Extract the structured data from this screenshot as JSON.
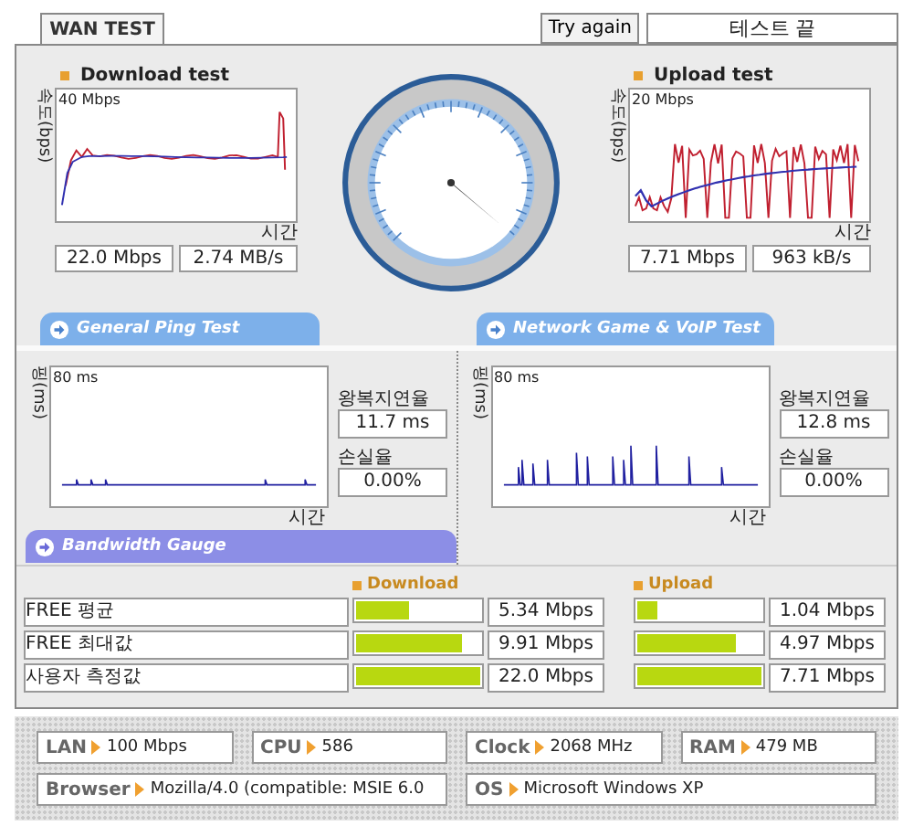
{
  "tab": {
    "label": "WAN TEST",
    "selected": true
  },
  "try_again_button": "Try again",
  "status": "테스트 끝",
  "speed_tests": [
    {
      "title": "Download test",
      "axis_label": "속도(bps)",
      "scale": "40 Mbps",
      "x_label": "시간",
      "speed": "22.0 Mbps",
      "rate": "2.74 MB/s",
      "kind": "download"
    },
    {
      "title": "Upload test",
      "axis_label": "속도(bps)",
      "scale": "20 Mbps",
      "x_label": "시간",
      "speed": "7.71 Mbps",
      "rate": "963 kB/s",
      "kind": "upload"
    }
  ],
  "ping_tests": [
    {
      "title": "General Ping Test",
      "axis_label": "핑(ms)",
      "scale": "80 ms",
      "x_label": "시간",
      "latency_label": "왕복지연율",
      "latency": "11.7 ms",
      "loss_label": "손실율",
      "loss": "0.00%",
      "kind": "quiet"
    },
    {
      "title": "Network Game & VoIP Test",
      "axis_label": "핑(ms)",
      "scale": "80 ms",
      "x_label": "시간",
      "latency_label": "왕복지연율",
      "latency": "12.8 ms",
      "loss_label": "손실율",
      "loss": "0.00%",
      "kind": "spiky"
    }
  ],
  "bandwidth_gauge": {
    "title": "Bandwidth Gauge",
    "columns": [
      "Download",
      "Upload"
    ],
    "rows": [
      {
        "label": "FREE 평균",
        "download": {
          "level": 0.43,
          "reading": "5.34 Mbps"
        },
        "upload": {
          "level": 0.16,
          "reading": "1.04 Mbps"
        }
      },
      {
        "label": "FREE 최대값",
        "download": {
          "level": 0.85,
          "reading": "9.91 Mbps"
        },
        "upload": {
          "level": 0.8,
          "reading": "4.97 Mbps"
        }
      },
      {
        "label": "사용자 측정값",
        "download": {
          "level": 1,
          "reading": "22.0 Mbps"
        },
        "upload": {
          "level": 1,
          "reading": "7.71 Mbps"
        }
      }
    ]
  },
  "system_info": [
    {
      "label": "LAN",
      "value": "100 Mbps"
    },
    {
      "label": "CPU",
      "value": "586"
    },
    {
      "label": "Clock",
      "value": "2068 MHz"
    },
    {
      "label": "RAM",
      "value": "479 MB"
    },
    {
      "label": "Browser",
      "value": "Mozilla/4.0 (compatible: MSIE 6.0"
    },
    {
      "label": "OS",
      "value": "Microsoft Windows XP"
    }
  ]
}
